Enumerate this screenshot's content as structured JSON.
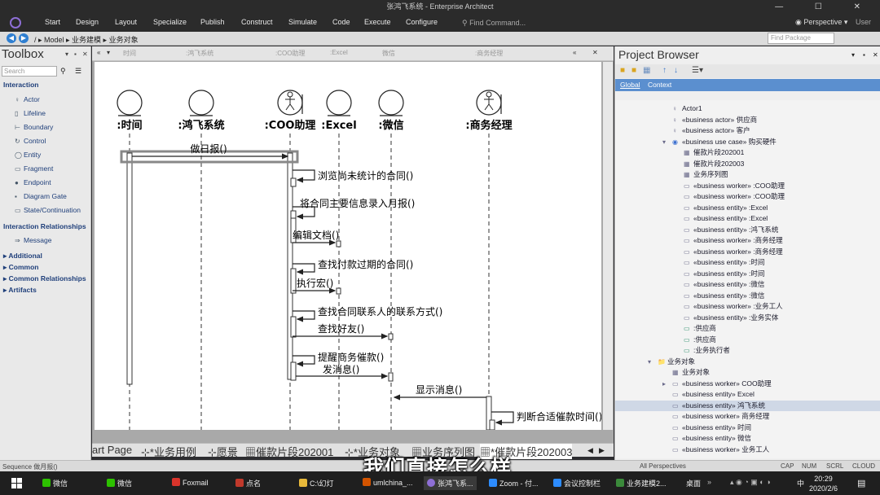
{
  "window": {
    "title": "张鸿飞系统 - Enterprise Architect",
    "controls": "— ☐ ✕"
  },
  "ribbon": {
    "menu": [
      "Start",
      "Design",
      "Layout",
      "Specialize",
      "Publish",
      "Construct",
      "Simulate",
      "Code",
      "Execute",
      "Configure"
    ],
    "find_placeholder": "Find Command...",
    "perspective": "Perspective",
    "user": "User"
  },
  "nav": {
    "breadcrumb": "/ ▸ Model ▸ 业务建模 ▸ 业务对象",
    "find_package_placeholder": "Find Package"
  },
  "toolbox": {
    "title": "Toolbox",
    "search_placeholder": "Search",
    "interaction_section": "Interaction",
    "interaction_items": [
      "Actor",
      "Lifeline",
      "Boundary",
      "Control",
      "Entity",
      "Fragment",
      "Endpoint",
      "Diagram Gate",
      "State/Continuation"
    ],
    "relationships_section": "Interaction Relationships",
    "relationship_items": [
      "Message"
    ],
    "other_sections": [
      "Additional",
      "Common",
      "Common Relationships",
      "Artifacts"
    ]
  },
  "diagram": {
    "ghost_header": [
      "时间",
      ":鸿飞系统",
      ":COO助理",
      ":Excel",
      "微信",
      ":商务经理"
    ],
    "lifelines": [
      {
        "label": ":时间",
        "kind": "entity"
      },
      {
        "label": ":鸿飞系统",
        "kind": "entity"
      },
      {
        "label": ":COO助理",
        "kind": "worker"
      },
      {
        "label": ":Excel",
        "kind": "entity"
      },
      {
        "label": ":微信",
        "kind": "entity"
      },
      {
        "label": ":商务经理",
        "kind": "worker"
      }
    ],
    "messages": [
      {
        "label": "做日报()"
      },
      {
        "label": "浏览尚未统计的合同()"
      },
      {
        "label": "将合同主要信息录入月报()"
      },
      {
        "label": "编辑文档()"
      },
      {
        "label": "查找付款过期的合同()"
      },
      {
        "label": "执行宏()"
      },
      {
        "label": "查找合同联系人的联系方式()"
      },
      {
        "label": "查找好友()"
      },
      {
        "label": "提醒商务催款()"
      },
      {
        "label": "发消息()"
      },
      {
        "label": "显示消息()"
      },
      {
        "label": "判断合适催款时间()"
      }
    ]
  },
  "diagram_tabs": [
    "art Page",
    "*业务用例",
    "愿景",
    "催款片段202001",
    "*业务对象",
    "业务序列图",
    "*催款片段202003"
  ],
  "project_browser": {
    "title": "Project Browser",
    "tabs": [
      "Global",
      "Context"
    ],
    "items": [
      {
        "icon": "♀",
        "text": "Actor1"
      },
      {
        "icon": "♀",
        "text": "«business actor» 供应商"
      },
      {
        "icon": "♀",
        "text": "«business actor» 客户"
      },
      {
        "icon": "◉",
        "text": "«business use case» 购买硬件"
      },
      {
        "icon": "▦",
        "text": "催款片段202001"
      },
      {
        "icon": "▦",
        "text": "催款片段202003"
      },
      {
        "icon": "▦",
        "text": "业务序列图"
      },
      {
        "icon": "▭",
        "text": "«business worker» :COO助理"
      },
      {
        "icon": "▭",
        "text": "«business worker» :COO助理"
      },
      {
        "icon": "▭",
        "text": "«business entity» :Excel"
      },
      {
        "icon": "▭",
        "text": "«business entity» :Excel"
      },
      {
        "icon": "▭",
        "text": "«business entity» :鸿飞系统"
      },
      {
        "icon": "▭",
        "text": "«business worker» :商务经理"
      },
      {
        "icon": "▭",
        "text": "«business worker» :商务经理"
      },
      {
        "icon": "▭",
        "text": "«business entity» :时间"
      },
      {
        "icon": "▭",
        "text": "«business entity» :时间"
      },
      {
        "icon": "▭",
        "text": "«business entity» :微信"
      },
      {
        "icon": "▭",
        "text": "«business entity» :微信"
      },
      {
        "icon": "▭",
        "text": "«business worker» :业务工人"
      },
      {
        "icon": "▭",
        "text": "«business entity» :业务实体"
      },
      {
        "icon": "▭",
        "text": ":供应商"
      },
      {
        "icon": "▭",
        "text": ":供应商"
      },
      {
        "icon": "▭",
        "text": ":业务执行者"
      },
      {
        "icon": "📁",
        "text": "业务对象"
      },
      {
        "icon": "▦",
        "text": "业务对象"
      },
      {
        "icon": "▭",
        "text": "«business worker» COO助理"
      },
      {
        "icon": "▭",
        "text": "«business entity» Excel"
      },
      {
        "icon": "▭",
        "text": "«business entity» 鸿飞系统"
      },
      {
        "icon": "▭",
        "text": "«business worker» 商务经理"
      },
      {
        "icon": "▭",
        "text": "«business entity» 时间"
      },
      {
        "icon": "▭",
        "text": "«business entity» 微信"
      },
      {
        "icon": "▭",
        "text": "«business worker» 业务工人"
      }
    ]
  },
  "status": {
    "left": "Sequence 做月报()",
    "perspectives": "All Perspectives",
    "caps": "CAP",
    "num": "NUM",
    "scrl": "SCRL",
    "cloud": "CLOUD"
  },
  "taskbar": {
    "items": [
      "微信",
      "微信",
      "Foxmail",
      "点名",
      "C:\\幻灯",
      "umlchina_...",
      "张鸿飞系...",
      "Zoom - 付...",
      "会议控制栏",
      "业务建模2..."
    ],
    "desktop": "桌面",
    "lang": "中",
    "time": "20:29",
    "date": "2020/2/6"
  },
  "subtitle": "我们直接怎么样"
}
